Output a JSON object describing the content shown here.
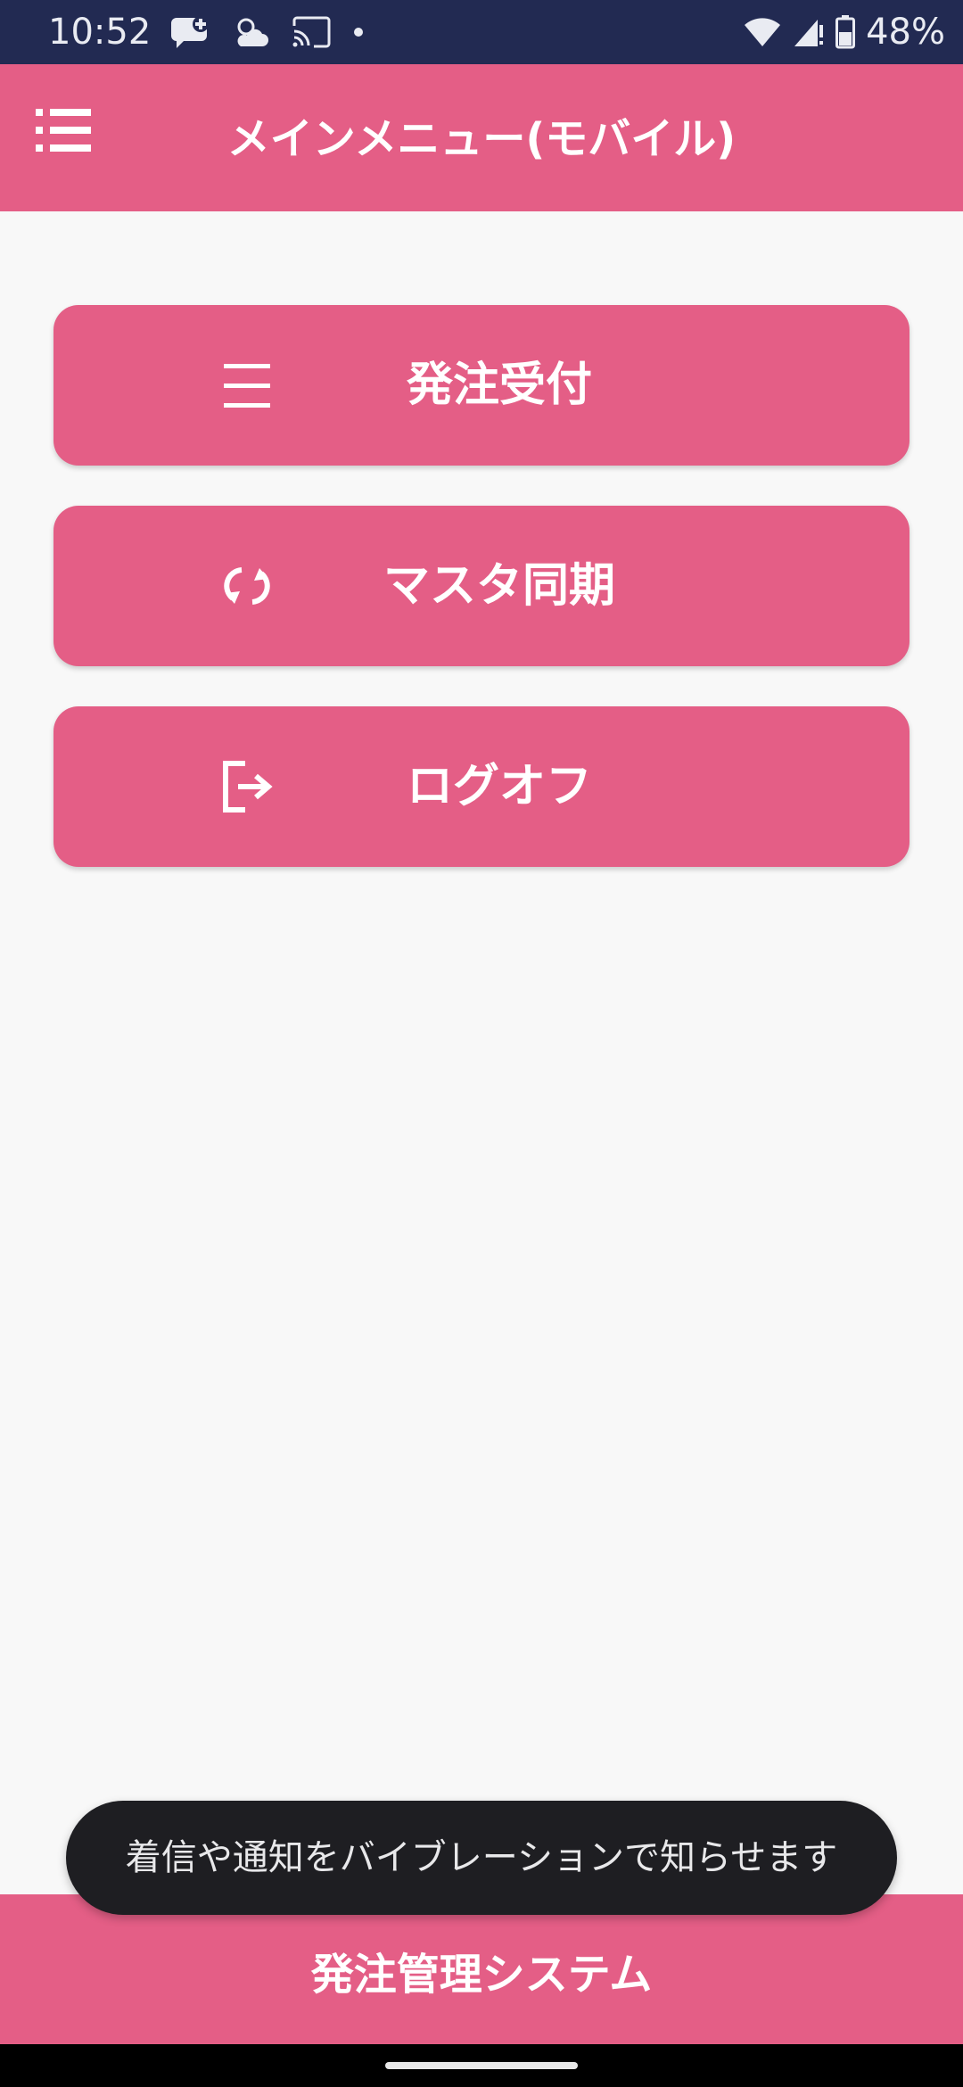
{
  "status_bar": {
    "time": "10:52",
    "battery": "48%",
    "icons": [
      "message-plus-icon",
      "weather-icon",
      "cast-icon",
      "dot-icon",
      "wifi-icon",
      "signal-icon",
      "battery-icon"
    ],
    "background": "#222a52"
  },
  "app_bar": {
    "title": "メインメニュー(モバイル)",
    "menu_icon": "menu-list-icon",
    "color": "#e45e86"
  },
  "menu": {
    "items": [
      {
        "label": "発注受付",
        "icon": "list-icon"
      },
      {
        "label": "マスタ同期",
        "icon": "sync-icon"
      },
      {
        "label": "ログオフ",
        "icon": "logout-icon"
      }
    ]
  },
  "toast": {
    "message": "着信や通知をバイブレーションで知らせます"
  },
  "footer": {
    "title": "発注管理システム"
  }
}
